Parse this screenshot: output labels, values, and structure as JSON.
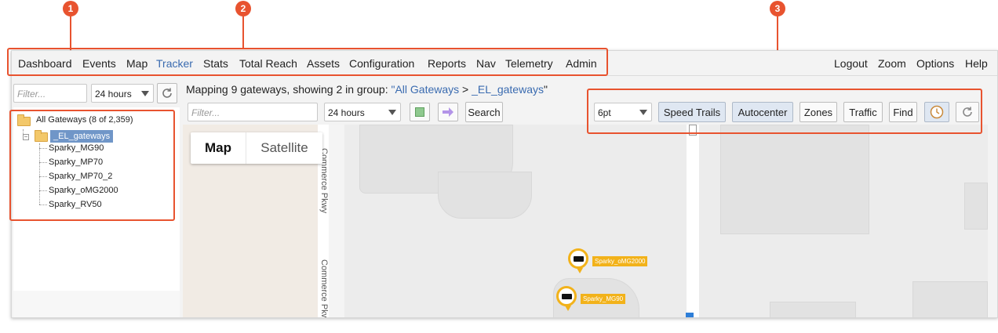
{
  "annotations": [
    "1",
    "2",
    "3"
  ],
  "menu": {
    "left": [
      "Dashboard",
      "Events",
      "Map",
      "Tracker",
      "Stats",
      "Total Reach",
      "Assets",
      "Configuration",
      "Reports",
      "Nav",
      "Telemetry",
      "Admin"
    ],
    "active": "Tracker",
    "right": [
      "Logout",
      "Zoom",
      "Options",
      "Help"
    ]
  },
  "left_panel": {
    "filter_placeholder": "Filter...",
    "time_select": "24 hours",
    "tree": {
      "root_label": "All Gateways (8 of 2,359)",
      "group_label": "_EL_gateways",
      "children": [
        "Sparky_MG90",
        "Sparky_MP70",
        "Sparky_MP70_2",
        "Sparky_oMG2000",
        "Sparky_RV50"
      ]
    }
  },
  "header": {
    "prefix": "Mapping 9 gateways, showing 2 in group: ",
    "crumb_root": "\"All Gateways",
    "separator": " > ",
    "crumb_group": "_EL_gateways",
    "suffix": "\""
  },
  "toolbar": {
    "filter_placeholder": "Filter...",
    "time_select": "24 hours",
    "search_label": "Search",
    "line_width_select": "6pt",
    "speed_trails_label": "Speed Trails",
    "autocenter_label": "Autocenter",
    "zones_label": "Zones",
    "traffic_label": "Traffic",
    "find_label": "Find"
  },
  "map": {
    "map_label": "Map",
    "satellite_label": "Satellite",
    "road_label_1": "Commerce Pkwy",
    "road_label_2": "Commerce Pkw",
    "markers": [
      "Sparky_oMG2000",
      "Sparky_MG90"
    ]
  },
  "colors": {
    "annotation": "#e8532f",
    "link": "#3a6bb0",
    "marker": "#f2b21a",
    "selected_node": "#7096c8"
  }
}
